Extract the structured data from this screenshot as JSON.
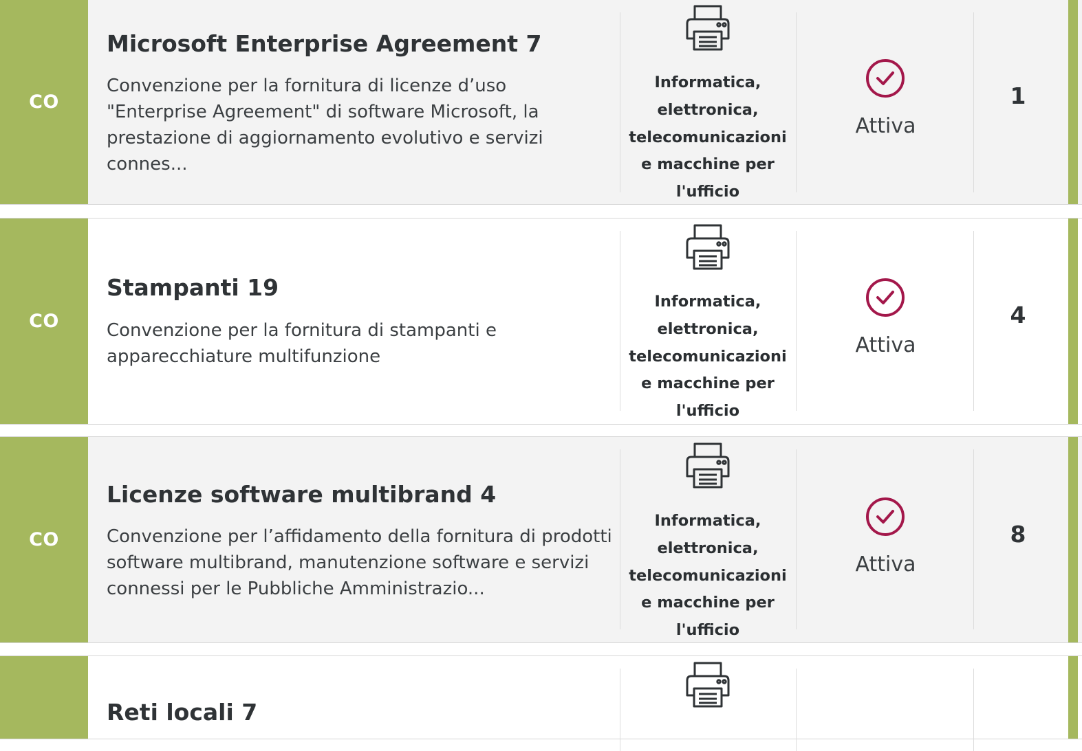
{
  "colors": {
    "type_badge_bg": "#a5b85e",
    "status_icon": "#a3174a",
    "row_alt_bg": "#f3f3f3"
  },
  "rows": [
    {
      "type": "CO",
      "title": "Microsoft Enterprise Agreement 7",
      "description": "Convenzione per la fornitura di licenze d’uso \"Enterprise Agreement\" di software Microsoft, la prestazione di aggiornamento evolutivo e servizi connes...",
      "category_icon": "printer-icon",
      "category": [
        "Informatica,",
        "elettronica,",
        "telecomunicazioni",
        "e macchine per",
        "l'ufficio"
      ],
      "status_icon": "check-circle-icon",
      "status": "Attiva",
      "count": "1"
    },
    {
      "type": "CO",
      "title": "Stampanti 19",
      "description": "Convenzione per la fornitura di stampanti e apparecchiature multifunzione",
      "category_icon": "printer-icon",
      "category": [
        "Informatica,",
        "elettronica,",
        "telecomunicazioni",
        "e macchine per",
        "l'ufficio"
      ],
      "status_icon": "check-circle-icon",
      "status": "Attiva",
      "count": "4"
    },
    {
      "type": "CO",
      "title": "Licenze software multibrand 4",
      "description": "Convenzione per l’affidamento della fornitura di prodotti software multibrand, manutenzione software e servizi connessi per le Pubbliche Amministrazio...",
      "category_icon": "printer-icon",
      "category": [
        "Informatica,",
        "elettronica,",
        "telecomunicazioni",
        "e macchine per",
        "l'ufficio"
      ],
      "status_icon": "check-circle-icon",
      "status": "Attiva",
      "count": "8"
    },
    {
      "type": "",
      "title": "Reti locali 7",
      "category_icon": "printer-icon"
    }
  ]
}
